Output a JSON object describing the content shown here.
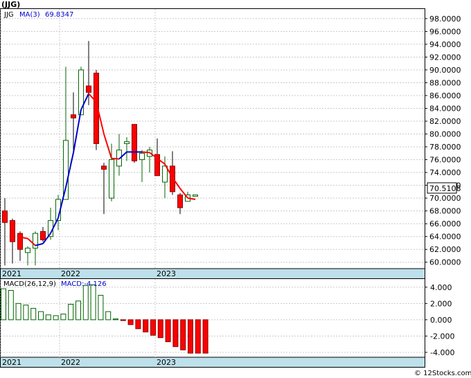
{
  "ticker": "(JJG)",
  "price_legend": {
    "symbol": "JJG",
    "ma_label": "MA(3)",
    "ma_value": "69.8347"
  },
  "macd_legend": {
    "label": "MACD(26,12,9)",
    "value_label": "MACD:-4.126"
  },
  "current_price": "70.5108",
  "watermark": "© 12Stocks.com",
  "colors": {
    "up": "#ffffff",
    "down": "#ff0000",
    "ma_up": "#0000cc",
    "ma_down": "#ff0000",
    "band": "#bde0ea",
    "hist": "#006400"
  },
  "chart_data": [
    {
      "type": "candlestick",
      "x_labels": [
        "2021",
        "2022",
        "2023"
      ],
      "ylim": [
        59,
        99.5
      ],
      "y_ticks": [
        "60.0000",
        "62.0000",
        "64.0000",
        "66.0000",
        "68.0000",
        "70.0000",
        "72.0000",
        "74.0000",
        "76.0000",
        "78.0000",
        "80.0000",
        "82.0000",
        "84.0000",
        "86.0000",
        "88.0000",
        "90.0000",
        "92.0000",
        "94.0000",
        "96.0000",
        "98.0000"
      ],
      "candles": [
        {
          "o": 68.0,
          "h": 70.0,
          "l": 59.5,
          "c": 66.2
        },
        {
          "o": 66.5,
          "h": 66.8,
          "l": 59.8,
          "c": 63.2
        },
        {
          "o": 64.5,
          "h": 64.8,
          "l": 60.2,
          "c": 62.0
        },
        {
          "o": 61.5,
          "h": 62.5,
          "l": 59.5,
          "c": 62.2
        },
        {
          "o": 62.2,
          "h": 64.8,
          "l": 59.5,
          "c": 64.5
        },
        {
          "o": 64.8,
          "h": 65.5,
          "l": 63.2,
          "c": 63.5
        },
        {
          "o": 64.0,
          "h": 68.5,
          "l": 63.5,
          "c": 66.5
        },
        {
          "o": 66.5,
          "h": 70.5,
          "l": 65.0,
          "c": 69.8
        },
        {
          "o": 69.8,
          "h": 90.5,
          "l": 69.8,
          "c": 79.0
        },
        {
          "o": 83.0,
          "h": 86.5,
          "l": 77.0,
          "c": 82.5
        },
        {
          "o": 83.0,
          "h": 90.5,
          "l": 83.0,
          "c": 90.0
        },
        {
          "o": 87.5,
          "h": 94.5,
          "l": 84.5,
          "c": 86.5
        },
        {
          "o": 89.5,
          "h": 90.0,
          "l": 77.5,
          "c": 78.5
        },
        {
          "o": 75.0,
          "h": 75.5,
          "l": 67.5,
          "c": 74.5
        },
        {
          "o": 70.0,
          "h": 78.5,
          "l": 69.5,
          "c": 76.0
        },
        {
          "o": 75.0,
          "h": 80.0,
          "l": 73.5,
          "c": 77.5
        },
        {
          "o": 78.5,
          "h": 79.5,
          "l": 75.8,
          "c": 78.8
        },
        {
          "o": 81.5,
          "h": 81.5,
          "l": 75.5,
          "c": 75.8
        },
        {
          "o": 76.0,
          "h": 77.5,
          "l": 72.5,
          "c": 77.0
        },
        {
          "o": 76.5,
          "h": 78.0,
          "l": 74.0,
          "c": 77.5
        },
        {
          "o": 76.8,
          "h": 79.3,
          "l": 73.5,
          "c": 73.5
        },
        {
          "o": 72.5,
          "h": 76.5,
          "l": 70.0,
          "c": 75.0
        },
        {
          "o": 75.0,
          "h": 77.3,
          "l": 70.5,
          "c": 71.0
        },
        {
          "o": 70.5,
          "h": 70.8,
          "l": 67.5,
          "c": 68.5
        },
        {
          "o": 69.5,
          "h": 71.0,
          "l": 69.5,
          "c": 70.5
        },
        {
          "o": 70.5,
          "h": 70.5,
          "l": 70.5,
          "c": 70.5
        }
      ],
      "ma": [
        null,
        null,
        63.9,
        63.7,
        62.6,
        62.9,
        64.5,
        66.9,
        71.7,
        77.1,
        83.8,
        86.3,
        85.0,
        80.0,
        76.2,
        76.1,
        77.2,
        77.2,
        77.2,
        77.1,
        76.2,
        75.3,
        73.2,
        71.5,
        70.0,
        69.8
      ]
    },
    {
      "type": "bar",
      "title": "MACD(26,12,9)",
      "ylim": [
        -4.6,
        5.0
      ],
      "y_ticks": [
        "4.000",
        "2.000",
        "0.000",
        "-2.000",
        "-4.000"
      ],
      "x_labels": [
        "2021",
        "2022",
        "2023"
      ],
      "values": [
        3.8,
        3.6,
        2.0,
        1.8,
        1.4,
        1.0,
        0.6,
        0.5,
        0.7,
        1.9,
        2.3,
        4.2,
        4.3,
        3.0,
        1.0,
        0.1,
        -0.1,
        -0.6,
        -1.1,
        -1.5,
        -1.9,
        -2.2,
        -2.7,
        -3.3,
        -3.7,
        -4.1,
        -4.1,
        -4.1
      ]
    }
  ]
}
